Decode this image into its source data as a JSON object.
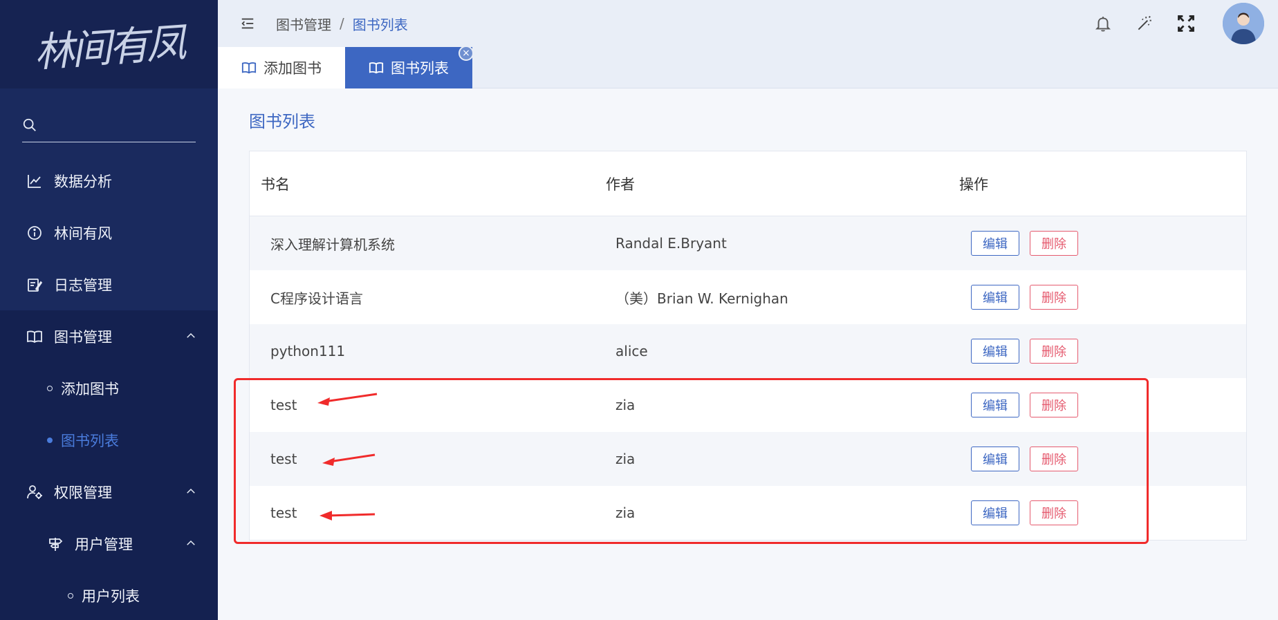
{
  "app": {
    "logo_text": "林间有凤"
  },
  "sidebar": {
    "search_placeholder": "",
    "items": [
      {
        "label": "数据分析",
        "icon": "chart-line-icon"
      },
      {
        "label": "林间有风",
        "icon": "info-icon"
      },
      {
        "label": "日志管理",
        "icon": "log-edit-icon"
      },
      {
        "label": "图书管理",
        "icon": "book-icon",
        "expanded": true
      },
      {
        "label": "权限管理",
        "icon": "user-settings-icon",
        "expanded": true
      }
    ],
    "book_sub": [
      {
        "label": "添加图书"
      },
      {
        "label": "图书列表",
        "active": true
      }
    ],
    "perm_sub": {
      "label": "用户管理",
      "icon": "signpost-icon"
    },
    "user_sub": [
      {
        "label": "用户列表"
      }
    ]
  },
  "header": {
    "breadcrumb": [
      "图书管理",
      "图书列表"
    ],
    "separator": "/"
  },
  "tabs": [
    {
      "label": "添加图书",
      "icon": "book-icon"
    },
    {
      "label": "图书列表",
      "icon": "book-icon",
      "active": true,
      "close": "×"
    }
  ],
  "main": {
    "title": "图书列表",
    "table": {
      "columns": [
        "书名",
        "作者",
        "操作"
      ],
      "rows": [
        {
          "name": "深入理解计算机系统",
          "author": "Randal E.Bryant"
        },
        {
          "name": "C程序设计语言",
          "author": "（美）Brian W. Kernighan"
        },
        {
          "name": "python111",
          "author": "alice"
        },
        {
          "name": "test",
          "author": "zia"
        },
        {
          "name": "test",
          "author": "zia"
        },
        {
          "name": "test",
          "author": "zia"
        }
      ],
      "edit_label": "编辑",
      "delete_label": "删除"
    }
  },
  "colors": {
    "sidebar_bg": "#1a2a5e",
    "accent": "#3d67c2",
    "danger": "#e55a6e",
    "annotation": "#f02b2b"
  }
}
